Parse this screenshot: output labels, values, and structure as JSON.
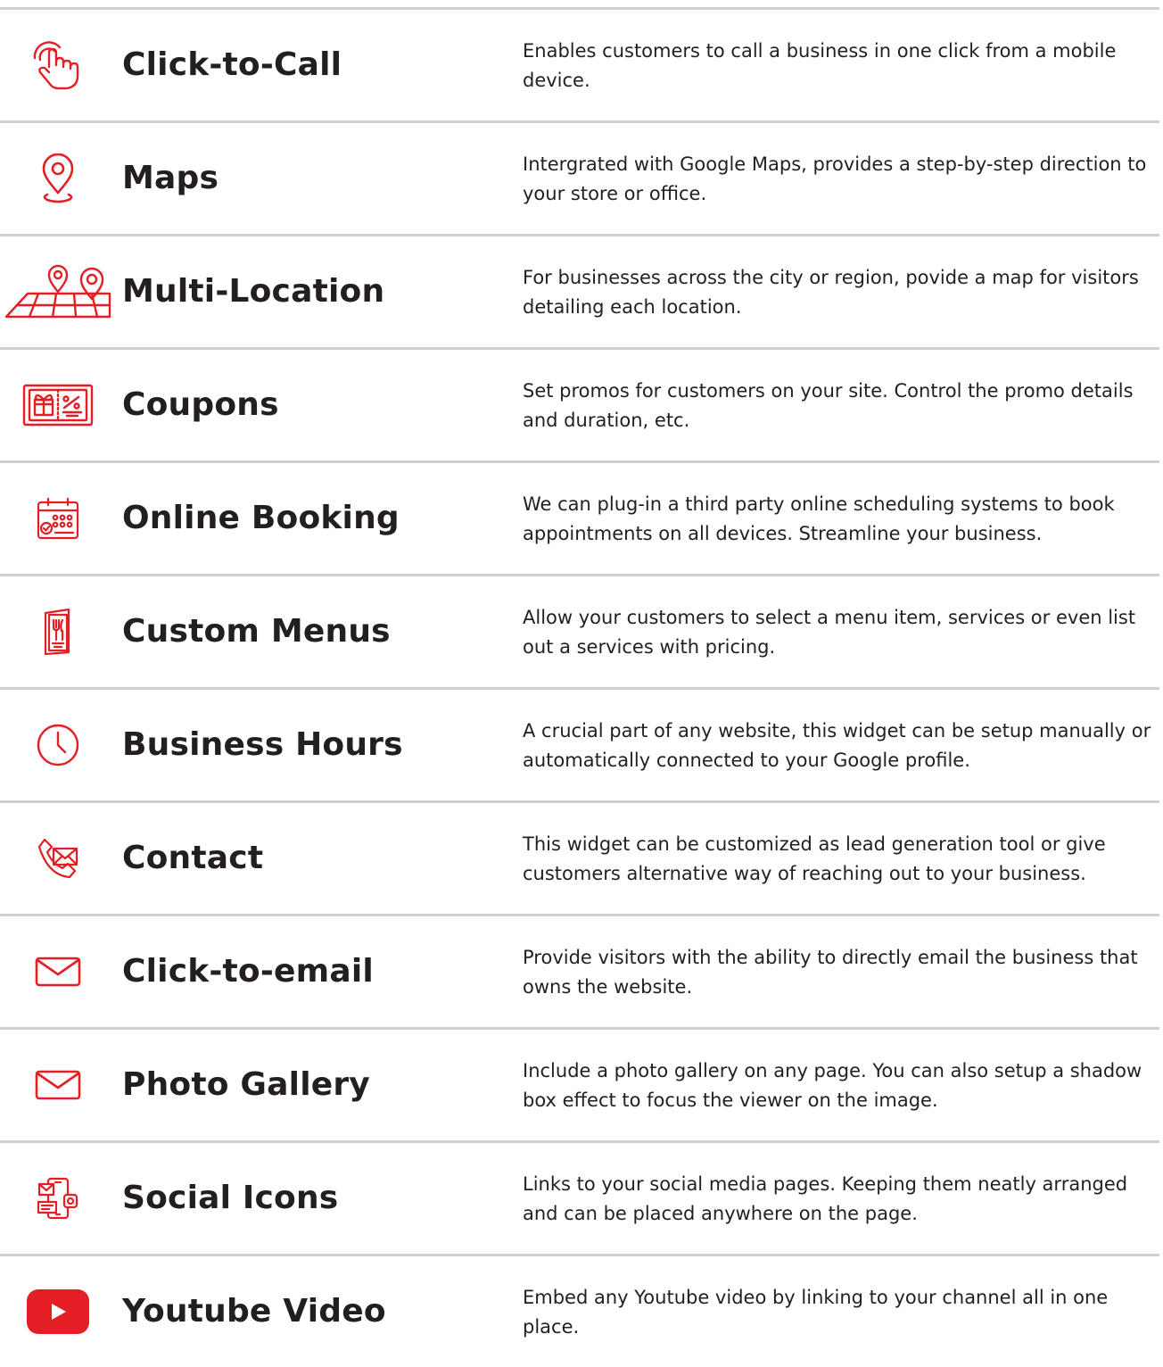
{
  "accent_color": "#e31e24",
  "divider_color": "#cfcfcf",
  "features": [
    {
      "icon": "hand-tap-icon",
      "title": "Click-to-Call",
      "description": "Enables customers to call a business in one click from a mobile device."
    },
    {
      "icon": "map-pin-icon",
      "title": "Maps",
      "description": "Intergrated with Google Maps, provides a step-by-step direction to your store or office."
    },
    {
      "icon": "multi-location-map-icon",
      "title": "Multi-Location",
      "description": "For businesses across the city or region, povide a map for visitors detailing each location."
    },
    {
      "icon": "coupon-gift-icon",
      "title": "Coupons",
      "description": "Set promos for customers on your site. Control the promo details and duration, etc."
    },
    {
      "icon": "calendar-icon",
      "title": "Online Booking",
      "description": "We can plug-in a third party online scheduling systems to book appointments on all devices. Streamline your business."
    },
    {
      "icon": "restaurant-menu-icon",
      "title": "Custom Menus",
      "description": "Allow your customers to select a menu item, services or even list out a services with pricing."
    },
    {
      "icon": "clock-icon",
      "title": "Business Hours",
      "description": "A crucial part of any website, this widget can be setup manually or automatically connected to your Google profile."
    },
    {
      "icon": "phone-envelope-icon",
      "title": "Contact",
      "description": "This widget can be customized as lead generation tool or give customers alternative way of reaching out to your business."
    },
    {
      "icon": "envelope-icon",
      "title": "Click-to-email",
      "description": "Provide visitors with the ability to directly email the business that owns the website."
    },
    {
      "icon": "envelope-icon",
      "title": "Photo Gallery",
      "description": "Include a photo gallery on any page. You can also setup a shadow box effect to focus the viewer on the image."
    },
    {
      "icon": "social-devices-icon",
      "title": "Social Icons",
      "description": "Links to your social media pages. Keeping them neatly arranged and can be placed anywhere on the page."
    },
    {
      "icon": "youtube-play-icon",
      "title": "Youtube Video",
      "description": "Embed any Youtube video by linking to your channel all in one place."
    }
  ]
}
